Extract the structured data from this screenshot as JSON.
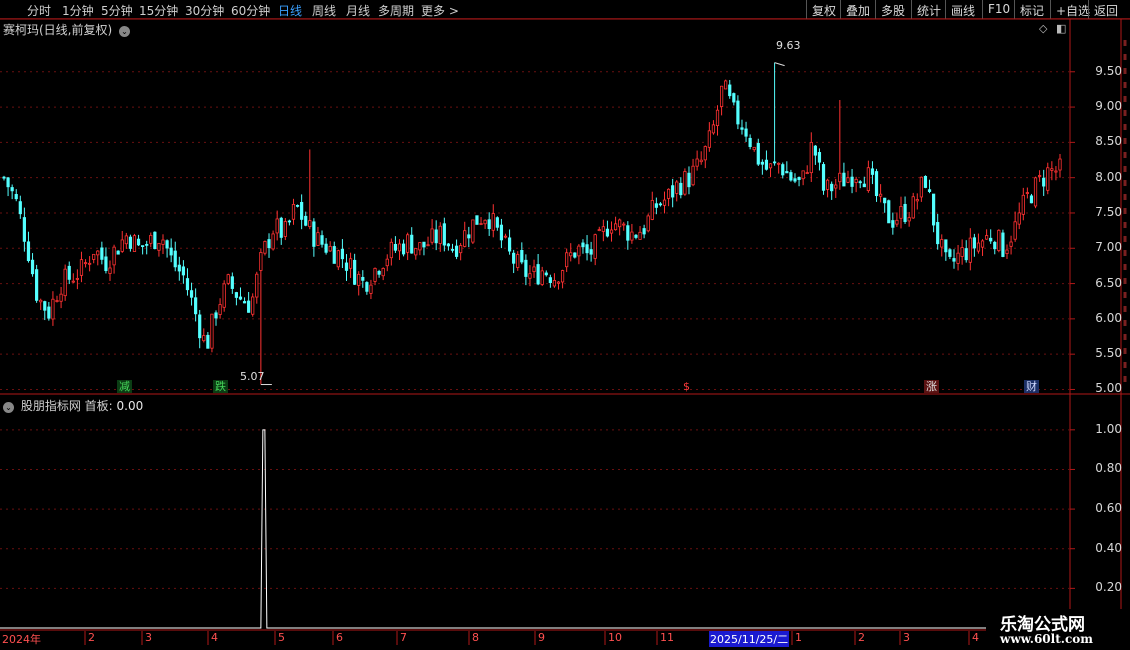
{
  "toolbar": {
    "periods": [
      "分时",
      "1分钟",
      "5分钟",
      "15分钟",
      "30分钟",
      "60分钟",
      "日线",
      "周线",
      "月线",
      "多周期",
      "更多 >"
    ],
    "active_period": "日线",
    "actions": [
      "复权",
      "叠加",
      "多股",
      "统计",
      "画线",
      "F10",
      "标记",
      "+自选",
      "返回"
    ]
  },
  "main_panel": {
    "title": "赛柯玛(日线,前复权)",
    "y_ticks": [
      "9.50",
      "9.00",
      "8.50",
      "8.00",
      "7.50",
      "7.00",
      "6.50",
      "6.00",
      "5.50",
      "5.00"
    ],
    "high_label": "9.63",
    "low_label": "5.07",
    "badges": [
      "减",
      "跌",
      "$",
      "涨",
      "财"
    ]
  },
  "indicator_panel": {
    "name": "股朋指标网",
    "indicator": "首板:",
    "value": "0.00",
    "y_ticks": [
      "1.00",
      "0.80",
      "0.60",
      "0.40",
      "0.20"
    ]
  },
  "date_axis": {
    "labels": [
      "2024年",
      "2",
      "3",
      "4",
      "5",
      "6",
      "7",
      "8",
      "9",
      "10",
      "11",
      "2025/11/25/二",
      "1",
      "2",
      "3",
      "4"
    ]
  },
  "watermark": {
    "title": "乐淘公式网",
    "url": "www.60lt.com"
  },
  "colors": {
    "up": "#ff3232",
    "down": "#54ffff",
    "grid": "#6a1010",
    "axis": "#b01818"
  },
  "chart_data": {
    "type": "candlestick",
    "title": "赛柯玛(日线,前复权)",
    "ylim": [
      4.95,
      9.95
    ],
    "x_months": [
      "2024年",
      "2",
      "3",
      "4",
      "5",
      "6",
      "7",
      "8",
      "9",
      "10",
      "11",
      "2025/11/25/二",
      "1",
      "2",
      "3",
      "4"
    ],
    "trend_close": [
      8.0,
      7.7,
      7.1,
      6.3,
      6.1,
      6.5,
      6.6,
      6.7,
      7.0,
      6.8,
      7.0,
      7.2,
      7.0,
      7.1,
      7.2,
      6.8,
      6.6,
      6.1,
      5.6,
      6.2,
      6.5,
      6.3,
      6.2,
      6.9,
      7.3,
      7.2,
      7.6,
      7.3,
      7.1,
      7.0,
      6.9,
      6.7,
      6.5,
      6.7,
      6.9,
      7.0,
      7.1,
      7.0,
      7.1,
      7.2,
      7.0,
      7.2,
      7.4,
      7.5,
      7.2,
      6.9,
      6.7,
      6.6,
      6.7,
      6.6,
      6.8,
      7.0,
      6.9,
      7.1,
      7.4,
      7.3,
      7.2,
      7.3,
      7.6,
      7.7,
      7.9,
      8.0,
      8.2,
      8.6,
      9.3,
      8.9,
      8.7,
      8.3,
      8.1,
      8.2,
      8.0,
      7.9,
      8.5,
      7.8,
      7.9,
      8.0,
      8.1,
      8.0,
      7.6,
      7.4,
      7.5,
      7.6,
      8.0,
      7.2,
      6.7,
      6.9,
      7.0,
      7.1,
      7.2,
      7.0,
      7.3,
      7.7,
      7.9,
      8.1,
      8.1
    ],
    "high": 9.63,
    "low": 5.07,
    "indicator": {
      "name": "首板",
      "ylim": [
        0,
        1.1
      ],
      "spike_month": "4",
      "spike_value": 1.0,
      "last_value": 0.0
    }
  }
}
